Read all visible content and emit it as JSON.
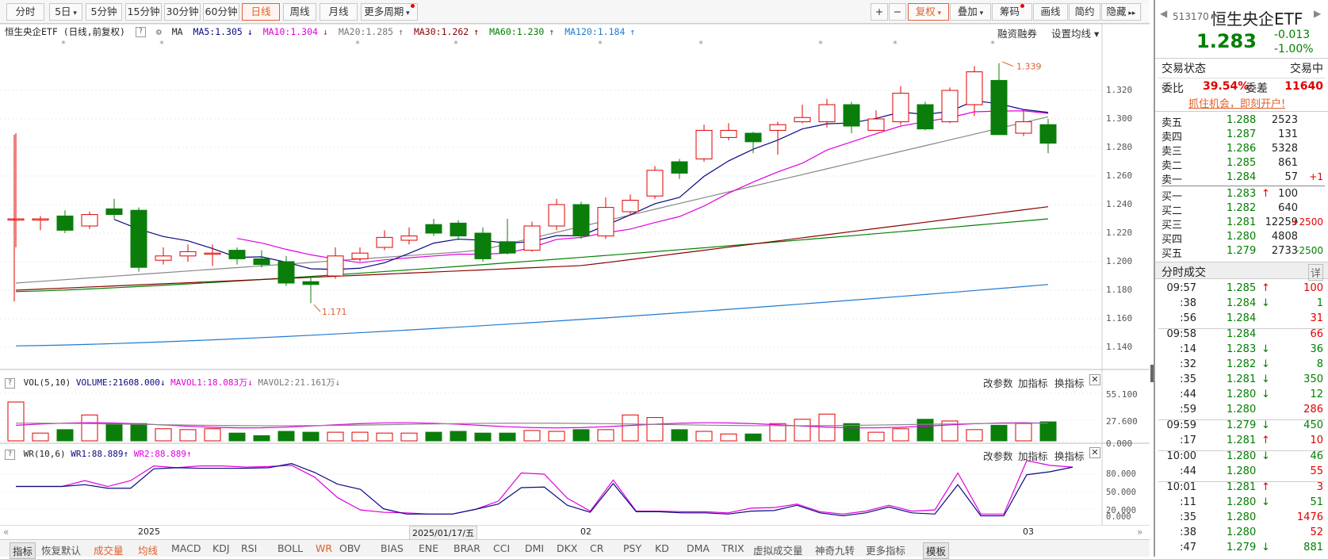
{
  "toolbar": {
    "periods": [
      "分时",
      "5日",
      "5分钟",
      "15分钟",
      "30分钟",
      "60分钟",
      "日线",
      "周线",
      "月线",
      "更多周期"
    ],
    "active_period": "日线",
    "plus": "+",
    "minus": "−",
    "right_buttons": [
      "复权",
      "叠加",
      "筹码",
      "画线",
      "简约",
      "隐藏"
    ]
  },
  "legend": {
    "title": "恒生央企ETF (日线,前复权)",
    "ma_label": "MA",
    "ma5": "MA5:1.305",
    "ma10": "MA10:1.304",
    "ma20": "MA20:1.285",
    "ma30": "MA30:1.262",
    "ma60": "MA60:1.230",
    "ma120": "MA120:1.184",
    "margin": "融资融券",
    "setting": "设置均线"
  },
  "colors": {
    "up": "#e00000",
    "down": "#0a7d0a",
    "ma5": "#0a0a80",
    "ma10": "#e000e0",
    "ma20": "#888888",
    "ma30": "#8b0000",
    "ma60": "#008000",
    "ma120": "#1e7bd0"
  },
  "price_axis": [
    "1.320",
    "1.300",
    "1.280",
    "1.260",
    "1.240",
    "1.220",
    "1.200",
    "1.180",
    "1.160",
    "1.140"
  ],
  "annotations": {
    "high": "1.339",
    "low": "1.171"
  },
  "volume": {
    "label": "VOL(5,10)",
    "volume": "VOLUME:21608.000",
    "mavol1": "MAVOL1:18.083万",
    "mavol2": "MAVOL2:21.161万",
    "axis": [
      "55.100",
      "27.600",
      "0.000"
    ],
    "tools": [
      "改参数",
      "加指标",
      "换指标"
    ]
  },
  "wr": {
    "label": "WR(10,6)",
    "wr1": "WR1:88.889",
    "wr2": "WR2:88.889",
    "axis": [
      "80.000",
      "50.000",
      "20.000",
      "0.000"
    ],
    "tools": [
      "改参数",
      "加指标",
      "换指标"
    ]
  },
  "dates": {
    "d1": "2025",
    "d2": "2025/01/17/五",
    "d3": "02",
    "d4": "03"
  },
  "bottom_tabs": [
    "指标",
    "恢复默认",
    "成交量",
    "均线",
    "MACD",
    "KDJ",
    "RSI",
    "BOLL",
    "WR",
    "OBV",
    "BIAS",
    "ENE",
    "BRAR",
    "CCI",
    "DMI",
    "DKX",
    "CR",
    "PSY",
    "KD",
    "DMA",
    "TRIX",
    "虚拟成交量",
    "神奇九转",
    "更多指标",
    "模板"
  ],
  "quote": {
    "code": "513170",
    "name": "恒生央企ETF",
    "price": "1.283",
    "change": "-0.013",
    "pct": "-1.00%",
    "status_label": "交易状态",
    "status": "交易中",
    "wb_label": "委比",
    "wb": "39.54%",
    "wc_label": "委差",
    "wc": "11640",
    "promo": "抓住机会，即刻开户!",
    "asks": [
      {
        "l": "卖五",
        "p": "1.288",
        "v": "2523",
        "c": ""
      },
      {
        "l": "卖四",
        "p": "1.287",
        "v": "131",
        "c": ""
      },
      {
        "l": "卖三",
        "p": "1.286",
        "v": "5328",
        "c": ""
      },
      {
        "l": "卖二",
        "p": "1.285",
        "v": "861",
        "c": ""
      },
      {
        "l": "卖一",
        "p": "1.284",
        "v": "57",
        "c": "+1"
      }
    ],
    "bids": [
      {
        "l": "买一",
        "p": "1.283",
        "v": "100",
        "c": ""
      },
      {
        "l": "买二",
        "p": "1.282",
        "v": "640",
        "c": ""
      },
      {
        "l": "买三",
        "p": "1.281",
        "v": "12259",
        "c": "+2500"
      },
      {
        "l": "买四",
        "p": "1.280",
        "v": "4808",
        "c": ""
      },
      {
        "l": "买五",
        "p": "1.279",
        "v": "2733",
        "c": "-2500"
      }
    ],
    "ticks_title": "分时成交",
    "ticks_detail": "详",
    "ticks": [
      {
        "t": "09:57",
        "p": "1.285",
        "d": "up",
        "v": "100"
      },
      {
        "t": ":38",
        "p": "1.284",
        "d": "down",
        "v": "1"
      },
      {
        "t": ":56",
        "p": "1.284",
        "d": "",
        "v": "31"
      },
      {
        "t": "09:58",
        "p": "1.284",
        "d": "",
        "v": "66"
      },
      {
        "t": ":14",
        "p": "1.283",
        "d": "down",
        "v": "36"
      },
      {
        "t": ":32",
        "p": "1.282",
        "d": "down",
        "v": "8"
      },
      {
        "t": ":35",
        "p": "1.281",
        "d": "down",
        "v": "350"
      },
      {
        "t": ":44",
        "p": "1.280",
        "d": "down",
        "v": "12"
      },
      {
        "t": ":59",
        "p": "1.280",
        "d": "",
        "v": "286"
      },
      {
        "t": "09:59",
        "p": "1.279",
        "d": "down",
        "v": "450"
      },
      {
        "t": ":17",
        "p": "1.281",
        "d": "up",
        "v": "10"
      },
      {
        "t": "10:00",
        "p": "1.280",
        "d": "down",
        "v": "46"
      },
      {
        "t": ":44",
        "p": "1.280",
        "d": "",
        "v": "55"
      },
      {
        "t": "10:01",
        "p": "1.281",
        "d": "up",
        "v": "3"
      },
      {
        "t": ":11",
        "p": "1.280",
        "d": "down",
        "v": "51"
      },
      {
        "t": ":35",
        "p": "1.280",
        "d": "",
        "v": "1476"
      },
      {
        "t": ":38",
        "p": "1.280",
        "d": "",
        "v": "52"
      },
      {
        "t": ":47",
        "p": "1.279",
        "d": "down",
        "v": "881"
      }
    ]
  },
  "chart_data": {
    "type": "candlestick",
    "candles": [
      [
        1.23,
        1.23,
        1.29,
        1.21
      ],
      [
        1.23,
        1.23,
        1.232,
        1.222
      ],
      [
        1.232,
        1.222,
        1.236,
        1.22
      ],
      [
        1.225,
        1.233,
        1.235,
        1.223
      ],
      [
        1.237,
        1.233,
        1.244,
        1.23
      ],
      [
        1.236,
        1.196,
        1.238,
        1.193
      ],
      [
        1.201,
        1.204,
        1.21,
        1.198
      ],
      [
        1.204,
        1.207,
        1.212,
        1.2
      ],
      [
        1.206,
        1.206,
        1.212,
        1.197
      ],
      [
        1.208,
        1.202,
        1.21,
        1.198
      ],
      [
        1.202,
        1.198,
        1.208,
        1.196
      ],
      [
        1.2,
        1.185,
        1.204,
        1.183
      ],
      [
        1.186,
        1.184,
        1.19,
        1.171
      ],
      [
        1.19,
        1.204,
        1.21,
        1.188
      ],
      [
        1.202,
        1.206,
        1.21,
        1.2
      ],
      [
        1.21,
        1.217,
        1.222,
        1.208
      ],
      [
        1.215,
        1.218,
        1.224,
        1.212
      ],
      [
        1.226,
        1.22,
        1.23,
        1.218
      ],
      [
        1.227,
        1.218,
        1.229,
        1.215
      ],
      [
        1.22,
        1.202,
        1.224,
        1.2
      ],
      [
        1.214,
        1.206,
        1.23,
        1.205
      ],
      [
        1.208,
        1.225,
        1.228,
        1.207
      ],
      [
        1.225,
        1.24,
        1.244,
        1.222
      ],
      [
        1.24,
        1.218,
        1.242,
        1.216
      ],
      [
        1.218,
        1.238,
        1.245,
        1.216
      ],
      [
        1.235,
        1.243,
        1.247,
        1.233
      ],
      [
        1.246,
        1.264,
        1.267,
        1.244
      ],
      [
        1.27,
        1.262,
        1.272,
        1.258
      ],
      [
        1.272,
        1.292,
        1.296,
        1.27
      ],
      [
        1.287,
        1.292,
        1.297,
        1.285
      ],
      [
        1.29,
        1.284,
        1.291,
        1.276
      ],
      [
        1.292,
        1.296,
        1.298,
        1.275
      ],
      [
        1.298,
        1.301,
        1.31,
        1.297
      ],
      [
        1.298,
        1.31,
        1.314,
        1.294
      ],
      [
        1.31,
        1.295,
        1.312,
        1.29
      ],
      [
        1.292,
        1.3,
        1.306,
        1.292
      ],
      [
        1.298,
        1.318,
        1.323,
        1.296
      ],
      [
        1.31,
        1.293,
        1.312,
        1.292
      ],
      [
        1.298,
        1.32,
        1.322,
        1.297
      ],
      [
        1.31,
        1.333,
        1.337,
        1.302
      ],
      [
        1.327,
        1.289,
        1.339,
        1.289
      ],
      [
        1.29,
        1.298,
        1.306,
        1.288
      ],
      [
        1.296,
        1.283,
        1.3,
        1.276
      ]
    ],
    "volume": [
      45,
      9,
      13,
      30,
      20,
      20,
      14,
      13,
      14,
      9,
      6,
      11,
      10,
      10,
      10,
      9,
      9,
      10,
      11,
      9,
      9,
      12,
      11,
      13,
      13,
      30,
      27,
      13,
      11,
      8,
      8,
      20,
      25,
      31,
      20,
      10,
      14,
      25,
      23,
      13,
      18,
      20,
      22,
      2
    ],
    "wr1": [
      52,
      52,
      52,
      55,
      49,
      49,
      82,
      84,
      83,
      83,
      83,
      84,
      91,
      76,
      56,
      47,
      14,
      5,
      5,
      5,
      13,
      22,
      50,
      51,
      20,
      8,
      57,
      9,
      9,
      7,
      7,
      5,
      10,
      11,
      20,
      7,
      2,
      7,
      17,
      7,
      5,
      55,
      2,
      2,
      72,
      77,
      85
    ],
    "wr2": [
      52,
      52,
      52,
      62,
      52,
      62,
      87,
      84,
      87,
      87,
      85,
      86,
      88,
      68,
      33,
      12,
      8,
      7,
      5,
      5,
      13,
      27,
      75,
      73,
      32,
      10,
      63,
      10,
      10,
      9,
      9,
      7,
      15,
      16,
      22,
      9,
      5,
      10,
      20,
      10,
      12,
      75,
      5,
      5,
      96,
      88,
      85
    ]
  }
}
